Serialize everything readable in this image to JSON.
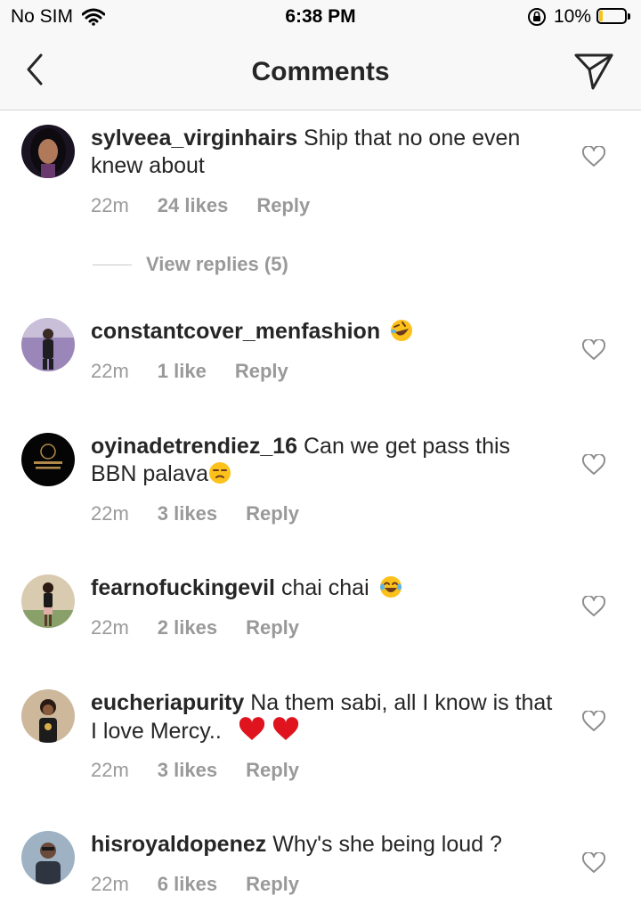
{
  "status_bar": {
    "carrier": "No SIM",
    "time": "6:38 PM",
    "battery": "10%"
  },
  "header": {
    "title": "Comments"
  },
  "comments": [
    {
      "username": "sylveea_virginhairs",
      "text": "Ship that no one even knew about",
      "emoji": "",
      "time": "22m",
      "likes": "24 likes",
      "reply": "Reply",
      "view_replies": "View replies (5)"
    },
    {
      "username": "constantcover_menfashion",
      "text": "",
      "emoji": "rolling-on-floor-laughing-emoji",
      "time": "22m",
      "likes": "1 like",
      "reply": "Reply"
    },
    {
      "username": "oyinadetrendiez_16",
      "text": "Can we get pass this BBN palava",
      "emoji": "unamused-face-emoji",
      "time": "22m",
      "likes": "3 likes",
      "reply": "Reply"
    },
    {
      "username": "fearnofuckingevil",
      "text": "chai chai",
      "emoji": "tears-of-joy-emoji",
      "time": "22m",
      "likes": "2 likes",
      "reply": "Reply"
    },
    {
      "username": "eucheriapurity",
      "text": "Na them sabi, all I know is that I love Mercy..",
      "emoji": "red-heart-emoji x2",
      "time": "22m",
      "likes": "3 likes",
      "reply": "Reply"
    },
    {
      "username": "hisroyaldopenez",
      "text": "Why's she being loud ?",
      "emoji": "",
      "time": "22m",
      "likes": "6 likes",
      "reply": "Reply"
    }
  ],
  "colors": {
    "text": "#262626",
    "meta": "#999999",
    "bar_bg": "#f8f8f8",
    "heart_outline": "#8e8e8e"
  }
}
